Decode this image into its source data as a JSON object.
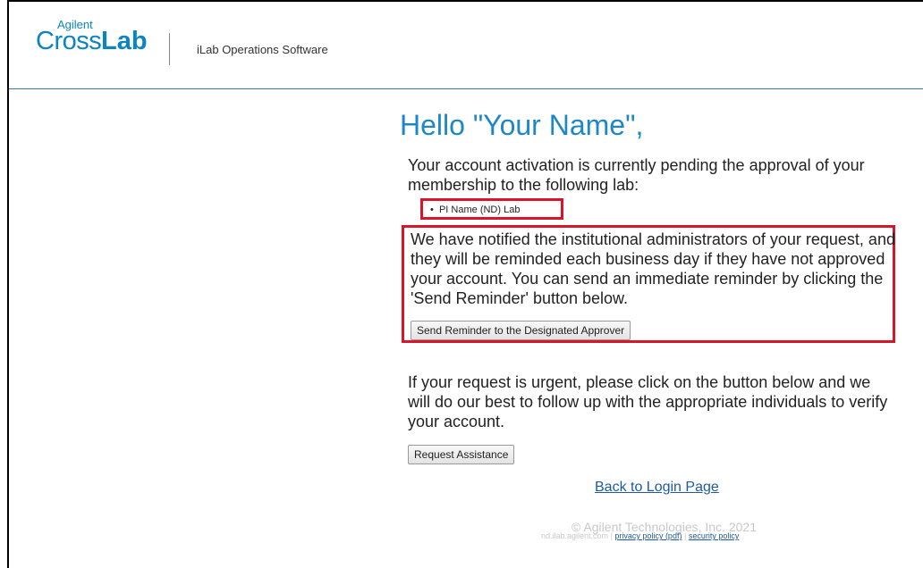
{
  "brand": {
    "logo_small": "Agilent",
    "logo_cross": "Cross",
    "logo_lab": "Lab",
    "product_name": "iLab Operations Software",
    "accent_color": "#1e87c7",
    "highlight_color": "#d7162a"
  },
  "main": {
    "greeting": "Hello \"Your Name\",",
    "pending_text": "Your account activation is currently pending the approval of your membership to the following lab:",
    "lab_name": "PI Name (ND) Lab",
    "notified_text": "We have notified the institutional administrators of your request, and they will be reminded each business day if they have not approved your account. You can send an immediate reminder by clicking the 'Send Reminder' button below.",
    "reminder_button": "Send Reminder to the Designated Approver",
    "urgent_text": "If your request is urgent, please click on the button below and we will do our best to follow up with the appropriate individuals to verify your account.",
    "assistance_button": "Request Assistance",
    "back_link": "Back to Login Page"
  },
  "footer": {
    "copyright": "© Agilent Technologies, Inc. 2021",
    "host": "nd.ilab.agilent.com",
    "separator": "|",
    "privacy_link": "privacy policy (pdf)",
    "security_link": "security policy"
  }
}
